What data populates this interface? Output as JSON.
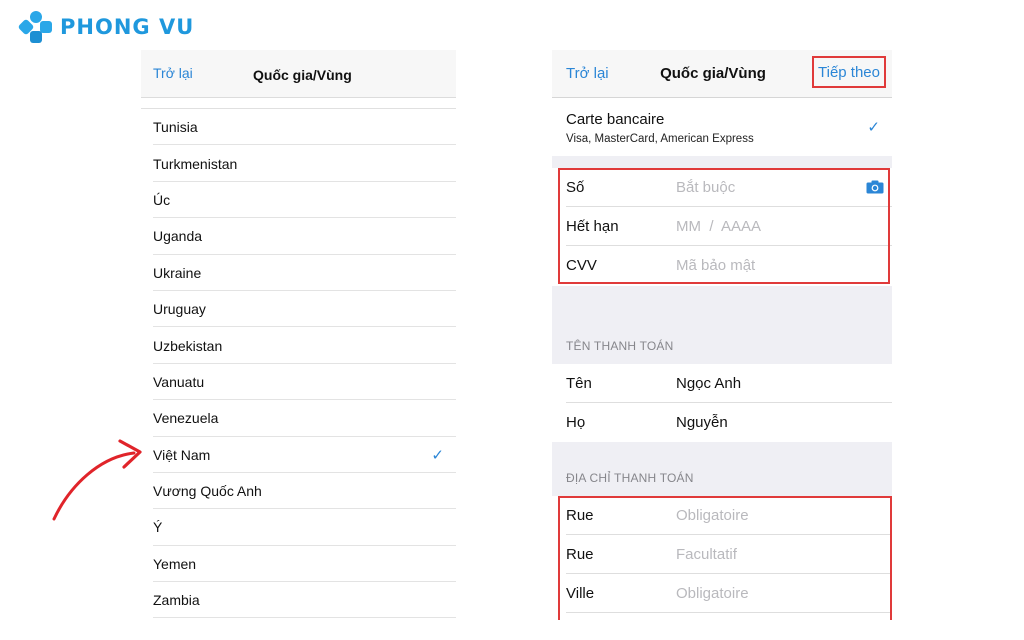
{
  "brand": {
    "name": "PHONG VU",
    "color": "#1f98dd"
  },
  "left_screen": {
    "back_label": "Trở lại",
    "title": "Quốc gia/Vùng",
    "countries": [
      {
        "name": "Tunisia",
        "selected": false
      },
      {
        "name": "Turkmenistan",
        "selected": false
      },
      {
        "name": "Úc",
        "selected": false
      },
      {
        "name": "Uganda",
        "selected": false
      },
      {
        "name": "Ukraine",
        "selected": false
      },
      {
        "name": "Uruguay",
        "selected": false
      },
      {
        "name": "Uzbekistan",
        "selected": false
      },
      {
        "name": "Vanuatu",
        "selected": false
      },
      {
        "name": "Venezuela",
        "selected": false
      },
      {
        "name": "Việt Nam",
        "selected": true
      },
      {
        "name": "Vương Quốc Anh",
        "selected": false
      },
      {
        "name": "Ý",
        "selected": false
      },
      {
        "name": "Yemen",
        "selected": false
      },
      {
        "name": "Zambia",
        "selected": false
      }
    ],
    "check_icon": "checkmark-icon"
  },
  "right_screen": {
    "back_label": "Trở lại",
    "title": "Quốc gia/Vùng",
    "next_label": "Tiếp theo",
    "payment_method": {
      "name": "Carte bancaire",
      "cards": "Visa, MasterCard, American Express",
      "selected": true
    },
    "card_fields": {
      "number_label": "Số",
      "number_placeholder": "Bắt buộc",
      "expiry_label": "Hết hạn",
      "expiry_placeholder": "MM  /  AAAA",
      "cvv_label": "CVV",
      "cvv_placeholder": "Mã bảo mật"
    },
    "billing_name": {
      "header": "TÊN THANH TOÁN",
      "first_label": "Tên",
      "first_value": "Ngọc Anh",
      "last_label": "Họ",
      "last_value": "Nguyễn"
    },
    "billing_address": {
      "header": "ĐỊA CHỈ THANH TOÁN",
      "street1_label": "Rue",
      "street1_placeholder": "Obligatoire",
      "street2_label": "Rue",
      "street2_placeholder": "Facultatif",
      "city_label": "Ville",
      "city_placeholder": "Obligatoire"
    }
  },
  "colors": {
    "accent": "#2b86d6",
    "highlight": "#e03a3a",
    "placeholder": "#b9b9bd"
  }
}
